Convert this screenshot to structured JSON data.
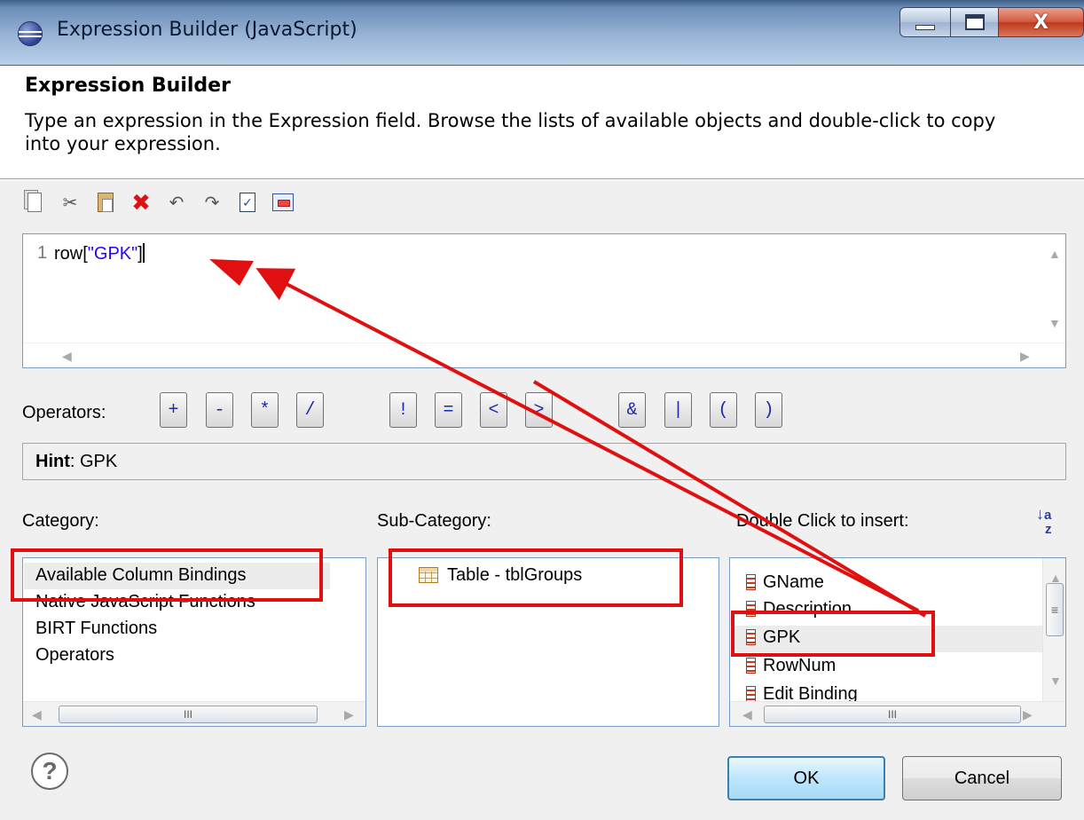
{
  "window": {
    "title": "Expression Builder (JavaScript)",
    "icon": "eclipse-icon",
    "controls": {
      "minimize": "minimize",
      "maximize": "maximize",
      "close": "X"
    }
  },
  "header": {
    "title": "Expression Builder",
    "description": "Type an expression in the Expression field. Browse the lists of available objects and double-click to copy into your expression."
  },
  "toolbar": {
    "icons": [
      "copy-icon",
      "cut-icon",
      "paste-icon",
      "delete-icon",
      "undo-icon",
      "redo-icon",
      "validate-icon",
      "operators-icon"
    ]
  },
  "editor": {
    "line_number": "1",
    "code_prefix": "row[",
    "code_string": "\"GPK\"",
    "code_suffix": "]"
  },
  "operators": {
    "label": "Operators:",
    "buttons": [
      "+",
      "-",
      "*",
      "/",
      "!",
      "=",
      "<",
      ">",
      "&",
      "|",
      "(",
      ")"
    ]
  },
  "hint": {
    "label": "Hint",
    "value": ": GPK"
  },
  "category": {
    "label": "Category:",
    "items": [
      "Available Column Bindings",
      "Native JavaScript Functions",
      "BIRT Functions",
      "Operators"
    ],
    "scroll_thumb": "III"
  },
  "subcategory": {
    "label": "Sub-Category:",
    "items": [
      "Table - tblGroups"
    ]
  },
  "insert": {
    "label": "Double Click to insert:",
    "sort_icon": "sort-az-icon",
    "sort_a": "a",
    "sort_z": "z",
    "items": [
      "GName",
      "Description",
      "GPK",
      "RowNum",
      "Edit Binding"
    ],
    "scroll_thumb": "III",
    "vscroll_thumb": "≡"
  },
  "footer": {
    "help": "?",
    "ok": "OK",
    "cancel": "Cancel"
  },
  "colors": {
    "annotation_red": "#e01010",
    "string_literal": "#2a00ff",
    "operator_text": "#1a2aa8"
  }
}
